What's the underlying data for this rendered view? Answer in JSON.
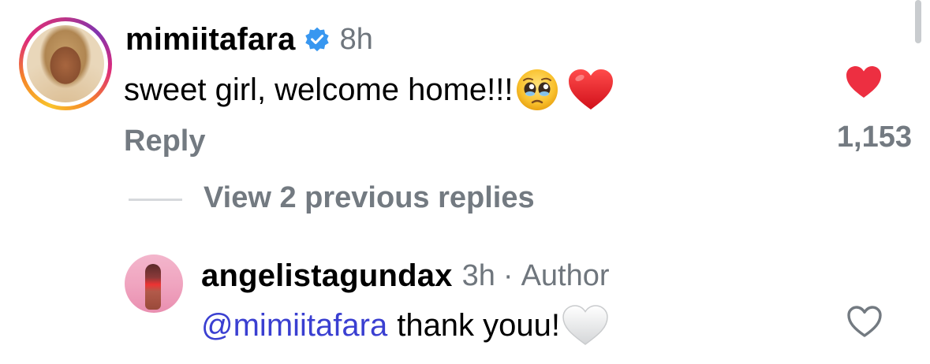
{
  "comment": {
    "username": "mimiitafara",
    "verified_icon": "verified-badge-icon",
    "time": "8h",
    "text": "sweet girl, welcome home!!!",
    "emojis": [
      "pleading-face-emoji",
      "red-heart-emoji"
    ],
    "reply_label": "Reply",
    "like_count": "1,153",
    "liked": true,
    "like_color": "#ed2f41"
  },
  "view_replies_label": "View 2 previous replies",
  "reply": {
    "username": "angelistagundax",
    "time": "3h",
    "separator": "·",
    "author_label": "Author",
    "mention": "@mimiitafara",
    "text": "thank youu!",
    "emojis": [
      "white-heart-emoji"
    ],
    "liked": false
  },
  "colors": {
    "mention": "#3a3fd1",
    "secondary_text": "#737a81",
    "verified": "#3897f0"
  }
}
